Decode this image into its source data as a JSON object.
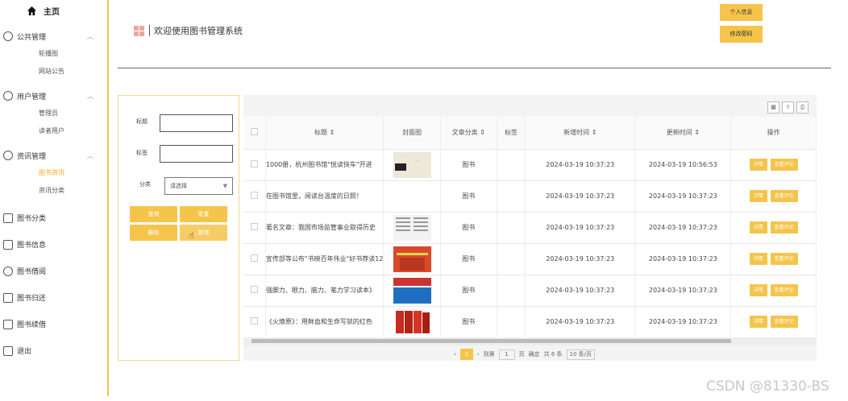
{
  "sidebar": {
    "home": "主页",
    "groups": [
      {
        "label": "公共管理",
        "subs": [
          "轮播图",
          "网站公告"
        ]
      },
      {
        "label": "用户管理",
        "subs": [
          "管理员",
          "读者用户"
        ]
      },
      {
        "label": "资讯管理",
        "subs": [
          "图书资讯",
          "资讯分类"
        ]
      }
    ],
    "items": [
      "图书分类",
      "图书信息",
      "图书借阅",
      "图书归还",
      "图书续借",
      "退出"
    ]
  },
  "topbar": {
    "profile": "个人信息",
    "change_password": "修改密码"
  },
  "welcome": "欢迎使用图书管理系统",
  "form": {
    "title_label": "标题",
    "tag_label": "标签",
    "category_label": "分类",
    "category_placeholder": "请选择",
    "query": "查询",
    "reset": "重置",
    "delete": "删除",
    "add": "新增"
  },
  "table": {
    "headers": [
      "标题",
      "封面图",
      "文章分类",
      "标签",
      "新增时间",
      "更新时间",
      "操作"
    ],
    "rows": [
      {
        "title": "1000册，杭州图书馆\"悦读快车\"开进",
        "category": "图书",
        "tag": "",
        "created": "2024-03-19 10:37:23",
        "updated": "2024-03-19 10:56:53"
      },
      {
        "title": "在图书馆里，阅读台温度的日照！",
        "category": "图书",
        "tag": "",
        "created": "2024-03-19 10:37:23",
        "updated": "2024-03-19 10:37:23"
      },
      {
        "title": "著名文章：我国市场监管事业取得历史",
        "category": "图书",
        "tag": "",
        "created": "2024-03-19 10:37:23",
        "updated": "2024-03-19 10:37:23"
      },
      {
        "title": "宣传部等公布\"书映百年伟业\"好书荐读12",
        "category": "图书",
        "tag": "",
        "created": "2024-03-19 10:37:23",
        "updated": "2024-03-19 10:37:23"
      },
      {
        "title": "强脚力、眼力、脑力、笔力学习读本》",
        "category": "图书",
        "tag": "",
        "created": "2024-03-19 10:37:23",
        "updated": "2024-03-19 10:37:23"
      },
      {
        "title": "《火燎原》：用鲜血和生命写就的红色",
        "category": "图书",
        "tag": "",
        "created": "2024-03-19 10:37:23",
        "updated": "2024-03-19 10:37:23"
      }
    ],
    "op_detail": "详情",
    "op_comment": "查看评论"
  },
  "pager": {
    "current": "1",
    "goto": "到第",
    "page_input": "1",
    "page_suffix": "页",
    "confirm": "确定",
    "total": "共 6 条",
    "page_size": "10 条/页"
  },
  "watermark": "CSDN @81330-BS",
  "colors": {
    "accent": "#f5c44a"
  }
}
